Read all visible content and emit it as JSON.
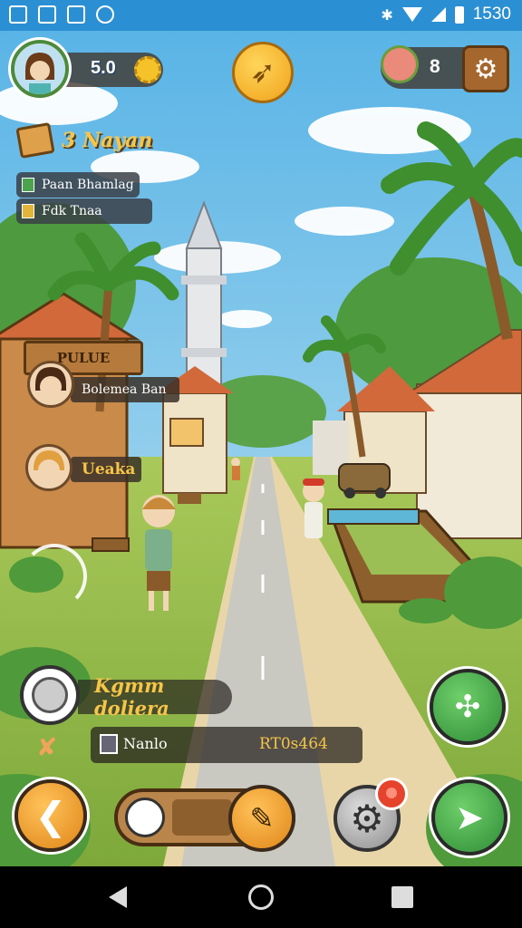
{
  "status_bar": {
    "time": "1530",
    "bluetooth": "bluetooth-icon",
    "notification_icons": [
      "gallery-icon",
      "photo-icon",
      "media-icon",
      "sync-icon"
    ]
  },
  "hud": {
    "coins": "5.0",
    "pets": "8",
    "days_label": "3 Nayan",
    "tasks": [
      {
        "label": "Paan Bhamlag",
        "icon": "check-icon"
      },
      {
        "label": "Fdk  Tnaa",
        "icon": "warn-icon"
      }
    ]
  },
  "world": {
    "sign_text": "PULUE",
    "npcs": [
      {
        "name": "Bolemea Ban"
      },
      {
        "name": "Ueaka"
      }
    ]
  },
  "location": {
    "name": "Kgmm doliera",
    "item_name": "Nanlo",
    "item_code": "RT0s464"
  },
  "colors": {
    "accent_gold": "#f6c548",
    "button_green": "#2f8d36",
    "button_orange": "#e08517",
    "status_bar": "#2b8fd3"
  }
}
